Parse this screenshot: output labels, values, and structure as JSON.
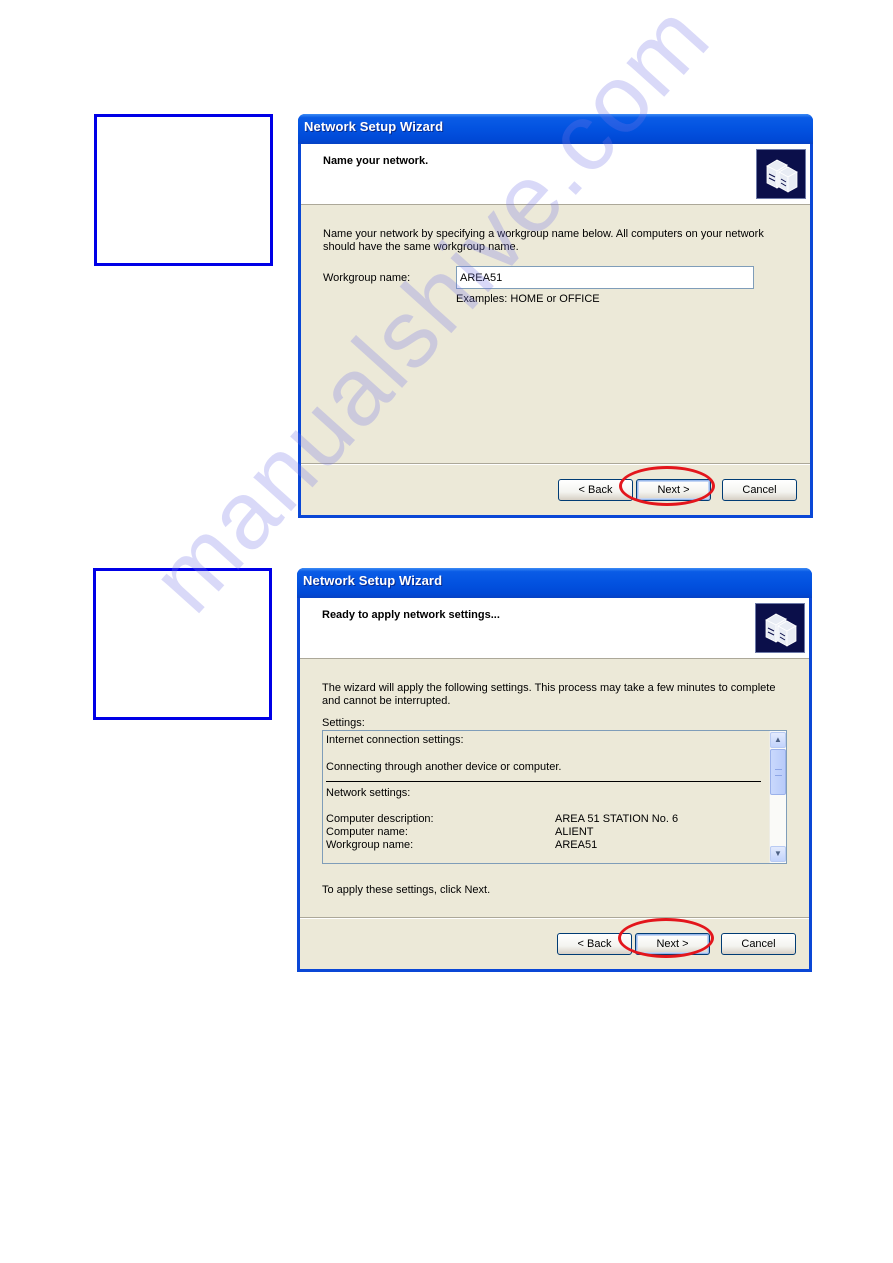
{
  "watermark": "manualshive.com",
  "colors": {
    "annotation_box": "#0000e6",
    "highlight_ellipse": "#e3161c",
    "titlebar": "#0352e0"
  },
  "wizard1": {
    "window_title": "Network Setup Wizard",
    "header_title": "Name your network.",
    "header_icon": "network-computers-icon",
    "description_line1": "Name your network by specifying a workgroup name below. All computers on your network",
    "description_line2": "should have the same workgroup name.",
    "workgroup_label": "Workgroup name:",
    "workgroup_value": "AREA51",
    "workgroup_hint": "Examples: HOME or OFFICE",
    "buttons": {
      "back": "< Back",
      "next": "Next >",
      "cancel": "Cancel"
    },
    "highlighted_button": "next"
  },
  "wizard2": {
    "window_title": "Network Setup Wizard",
    "header_title": "Ready to apply network settings...",
    "header_icon": "network-computers-icon",
    "description_line1": "The wizard will apply the following settings. This process may take a few minutes to complete",
    "description_line2": "and cannot be interrupted.",
    "settings_label": "Settings:",
    "settings": {
      "internet_heading": "Internet connection settings:",
      "internet_value": "Connecting through another device or computer.",
      "network_heading": "Network settings:",
      "rows": [
        {
          "label": "Computer description:",
          "value": "AREA 51 STATION No. 6"
        },
        {
          "label": "Computer name:",
          "value": "ALIENT"
        },
        {
          "label": "Workgroup name:",
          "value": "AREA51"
        }
      ]
    },
    "scroll_up": "▲",
    "scroll_down": "▼",
    "apply_text": "To apply these settings, click Next.",
    "buttons": {
      "back": "< Back",
      "next": "Next >",
      "cancel": "Cancel"
    },
    "highlighted_button": "next"
  }
}
